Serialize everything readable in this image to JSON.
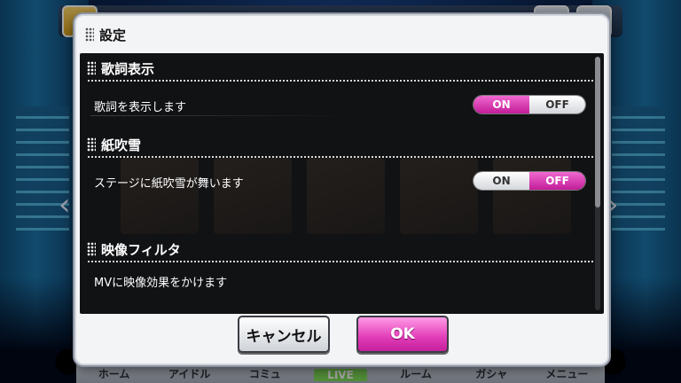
{
  "dialog": {
    "title": "設定",
    "sections": [
      {
        "title": "歌詞表示",
        "description": "歌詞を表示します",
        "toggle": {
          "on_label": "ON",
          "off_label": "OFF",
          "selected": "ON"
        }
      },
      {
        "title": "紙吹雪",
        "description": "ステージに紙吹雪が舞います",
        "toggle": {
          "on_label": "ON",
          "off_label": "OFF",
          "selected": "OFF"
        }
      },
      {
        "title": "映像フィルタ",
        "description": "MVに映像効果をかけます"
      }
    ],
    "buttons": {
      "cancel": "キャンセル",
      "ok": "OK"
    }
  },
  "background": {
    "nav": [
      "ホーム",
      "アイドル",
      "コミュ",
      "LIVE",
      "ルーム",
      "ガシャ",
      "メニュー"
    ]
  },
  "colors": {
    "accent": "#e13cb7",
    "panel": "#111214"
  }
}
